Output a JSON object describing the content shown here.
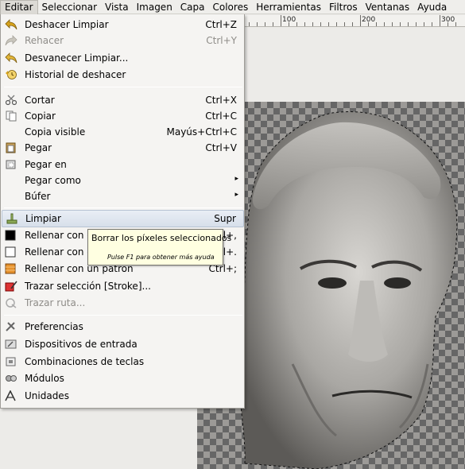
{
  "menubar": {
    "items": [
      "Editar",
      "Seleccionar",
      "Vista",
      "Imagen",
      "Capa",
      "Colores",
      "Herramientas",
      "Filtros",
      "Ventanas",
      "Ayuda"
    ]
  },
  "ruler": {
    "labels": [
      "100",
      "200",
      "300"
    ]
  },
  "menu": {
    "items": [
      {
        "label": "Deshacer Limpiar",
        "shortcut": "Ctrl+Z",
        "icon": "undo-icon",
        "disabled": false
      },
      {
        "label": "Rehacer",
        "shortcut": "Ctrl+Y",
        "icon": "redo-icon",
        "disabled": true
      },
      {
        "label": "Desvanecer Limpiar...",
        "shortcut": "",
        "icon": "fade-icon",
        "disabled": false
      },
      {
        "label": "Historial de deshacer",
        "shortcut": "",
        "icon": "history-icon",
        "disabled": false
      },
      {
        "label": "Cortar",
        "shortcut": "Ctrl+X",
        "icon": "scissors-icon",
        "disabled": false
      },
      {
        "label": "Copiar",
        "shortcut": "Ctrl+C",
        "icon": "copy-icon",
        "disabled": false
      },
      {
        "label": "Copia visible",
        "shortcut": "Mayús+Ctrl+C",
        "icon": "",
        "disabled": false
      },
      {
        "label": "Pegar",
        "shortcut": "Ctrl+V",
        "icon": "paste-icon",
        "disabled": false
      },
      {
        "label": "Pegar en",
        "shortcut": "",
        "icon": "paste-into-icon",
        "disabled": false
      },
      {
        "label": "Pegar como",
        "shortcut": "",
        "icon": "",
        "disabled": false,
        "submenu": true
      },
      {
        "label": "Búfer",
        "shortcut": "",
        "icon": "",
        "disabled": false,
        "submenu": true
      },
      {
        "label": "Limpiar",
        "shortcut": "Supr",
        "icon": "clear-icon",
        "disabled": false
      },
      {
        "label": "Rellenar con el color de frente",
        "shortcut": "Ctrl+,",
        "icon": "fg-fill-icon",
        "disabled": false
      },
      {
        "label": "Rellenar con el color de fondo",
        "shortcut": "Ctrl+.",
        "icon": "bg-fill-icon",
        "disabled": false
      },
      {
        "label": "Rellenar con un patrón",
        "shortcut": "Ctrl+;",
        "icon": "pattern-fill-icon",
        "disabled": false
      },
      {
        "label": "Trazar selección [Stroke]...",
        "shortcut": "",
        "icon": "stroke-selection-icon",
        "disabled": false
      },
      {
        "label": "Trazar ruta...",
        "shortcut": "",
        "icon": "stroke-path-icon",
        "disabled": true
      },
      {
        "label": "Preferencias",
        "shortcut": "",
        "icon": "preferences-icon",
        "disabled": false
      },
      {
        "label": "Dispositivos de entrada",
        "shortcut": "",
        "icon": "input-devices-icon",
        "disabled": false
      },
      {
        "label": "Combinaciones de teclas",
        "shortcut": "",
        "icon": "keyboard-icon",
        "disabled": false
      },
      {
        "label": "Módulos",
        "shortcut": "",
        "icon": "modules-icon",
        "disabled": false
      },
      {
        "label": "Unidades",
        "shortcut": "",
        "icon": "units-icon",
        "disabled": false
      }
    ],
    "submenu_arrow": "▸"
  },
  "tooltip": {
    "title": "Borrar los píxeles seleccionados",
    "hint": "Pulse F1 para obtener más ayuda"
  },
  "colors": {
    "highlight": "#d7dfea",
    "tooltip_bg": "#ffffe1",
    "disabled_text": "#8e8c88"
  }
}
